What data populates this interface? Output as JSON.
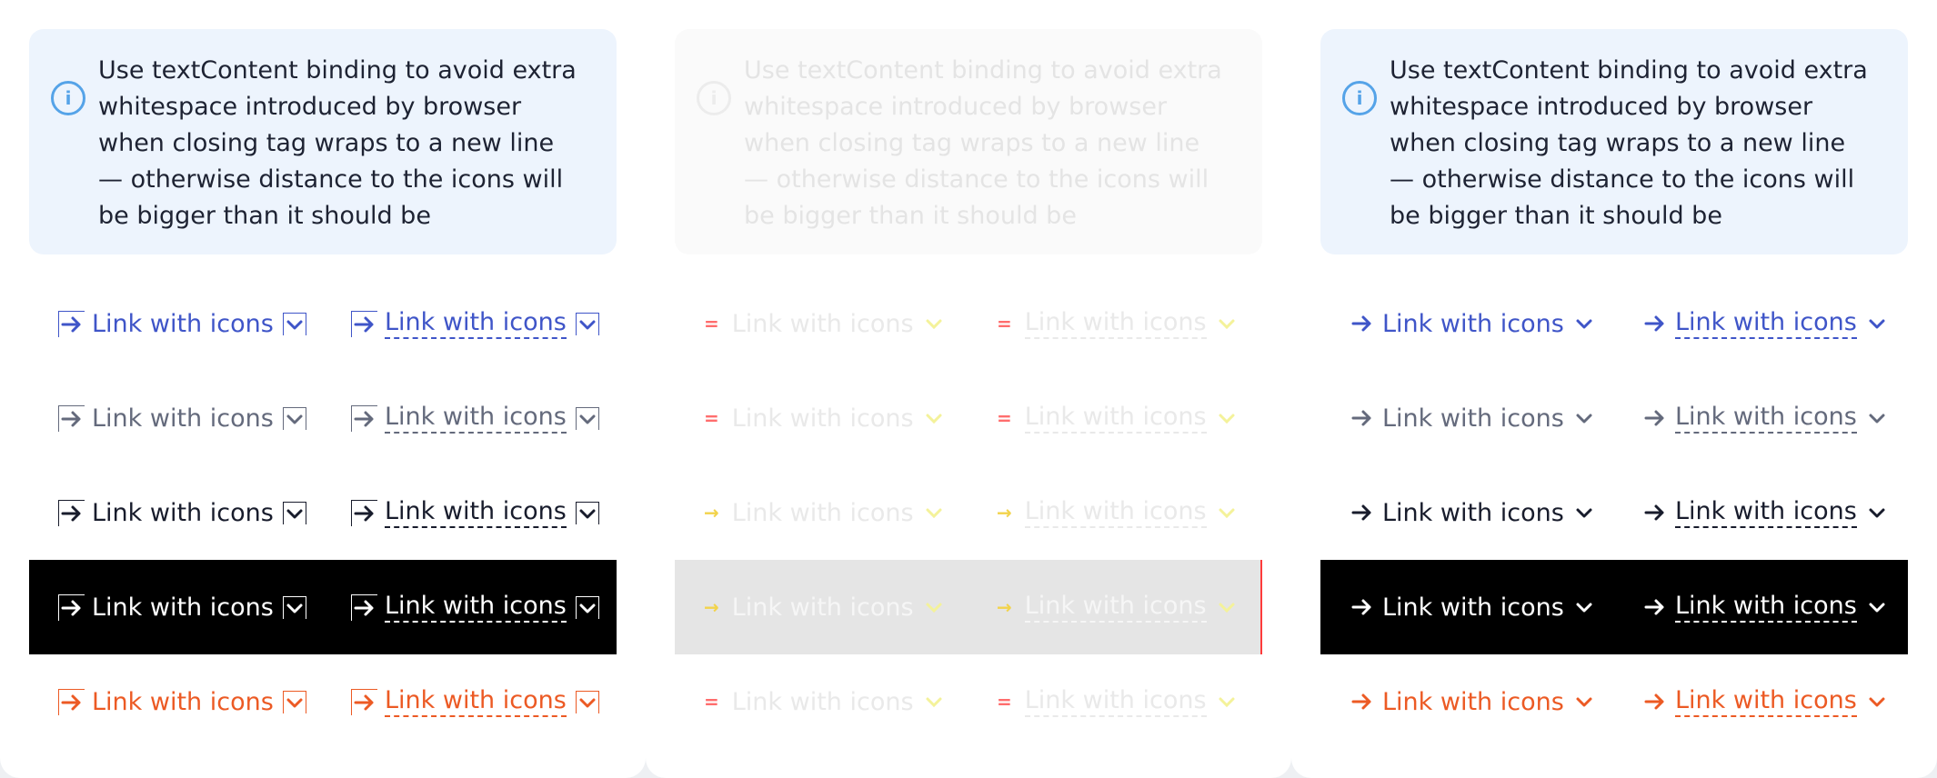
{
  "note": {
    "text": "Use textContent binding to avoid extra whitespace introduced by browser when closing tag wraps to a new line — otherwise distance to the icons will be bigger than it should be"
  },
  "link": {
    "label": "Link with icons"
  },
  "icons": {
    "info": "info-icon",
    "arrow": "arrow-right-icon",
    "chevron": "chevron-down-icon"
  },
  "colors": {
    "primary": "#3f55c8",
    "secondary": "#646a7c",
    "dark": "#181c2c",
    "inverse": "#ffffff",
    "danger": "#ec5a24",
    "note_bg": "#edf4fd",
    "info_icon": "#55a3e8"
  }
}
